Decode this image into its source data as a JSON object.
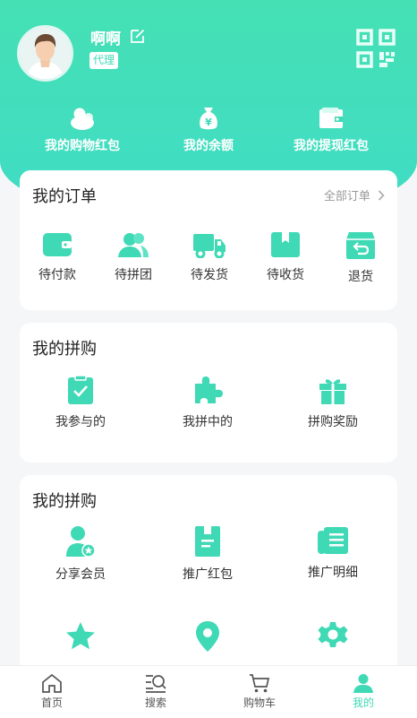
{
  "user": {
    "name": "啊啊",
    "badge": "代理"
  },
  "wallet": [
    {
      "label": "我的购物红包",
      "icon": "wallet-coins-icon"
    },
    {
      "label": "我的余额",
      "icon": "money-bag-icon"
    },
    {
      "label": "我的提现红包",
      "icon": "card-wallet-icon"
    }
  ],
  "orders": {
    "title": "我的订单",
    "all_link": "全部订单",
    "items": [
      {
        "label": "待付款",
        "icon": "wallet-icon"
      },
      {
        "label": "待拼团",
        "icon": "group-icon"
      },
      {
        "label": "待发货",
        "icon": "truck-icon"
      },
      {
        "label": "待收货",
        "icon": "box-icon"
      },
      {
        "label": "退货",
        "icon": "return-icon"
      }
    ]
  },
  "group_buy": {
    "title": "我的拼购",
    "items": [
      {
        "label": "我参与的",
        "icon": "clipboard-check-icon"
      },
      {
        "label": "我拼中的",
        "icon": "puzzle-icon"
      },
      {
        "label": "拼购奖励",
        "icon": "gift-icon"
      }
    ]
  },
  "promo": {
    "title": "我的拼购",
    "items": [
      {
        "label": "分享会员",
        "icon": "user-star-icon"
      },
      {
        "label": "推广红包",
        "icon": "envelope-icon"
      },
      {
        "label": "推广明细",
        "icon": "ledger-icon"
      },
      {
        "label": "",
        "icon": "star-icon"
      },
      {
        "label": "",
        "icon": "location-pin-icon"
      },
      {
        "label": "",
        "icon": "settings-gear-icon"
      }
    ]
  },
  "tabbar": [
    {
      "label": "首页",
      "icon": "home-icon"
    },
    {
      "label": "搜索",
      "icon": "search-icon"
    },
    {
      "label": "购物车",
      "icon": "cart-icon"
    },
    {
      "label": "我的",
      "icon": "user-icon",
      "active": true
    }
  ],
  "colors": {
    "accent": "#3fd9b5",
    "header_top": "#45e0b4",
    "header_bottom": "#3fdcc6"
  }
}
